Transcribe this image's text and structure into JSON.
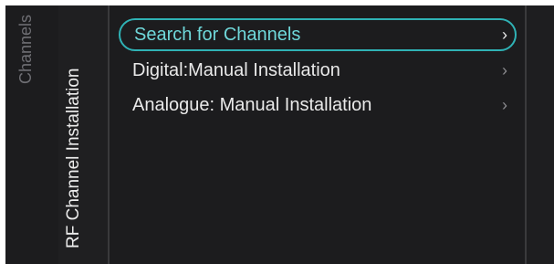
{
  "breadcrumb": {
    "level1": "Channels",
    "level2": "RF Channel Installation"
  },
  "menu": {
    "items": [
      {
        "label": "Search for Channels",
        "selected": true
      },
      {
        "label": "Digital:Manual Installation",
        "selected": false
      },
      {
        "label": "Analogue: Manual Installation",
        "selected": false
      }
    ],
    "chevron": "›",
    "chevron_icon": "chevron-right-icon"
  },
  "colors": {
    "background": "#1c1c1e",
    "accent": "#2fb2b5",
    "selected_text": "#6fd7d9",
    "text": "#e9e9e9",
    "dim_text": "#6e6e73"
  }
}
